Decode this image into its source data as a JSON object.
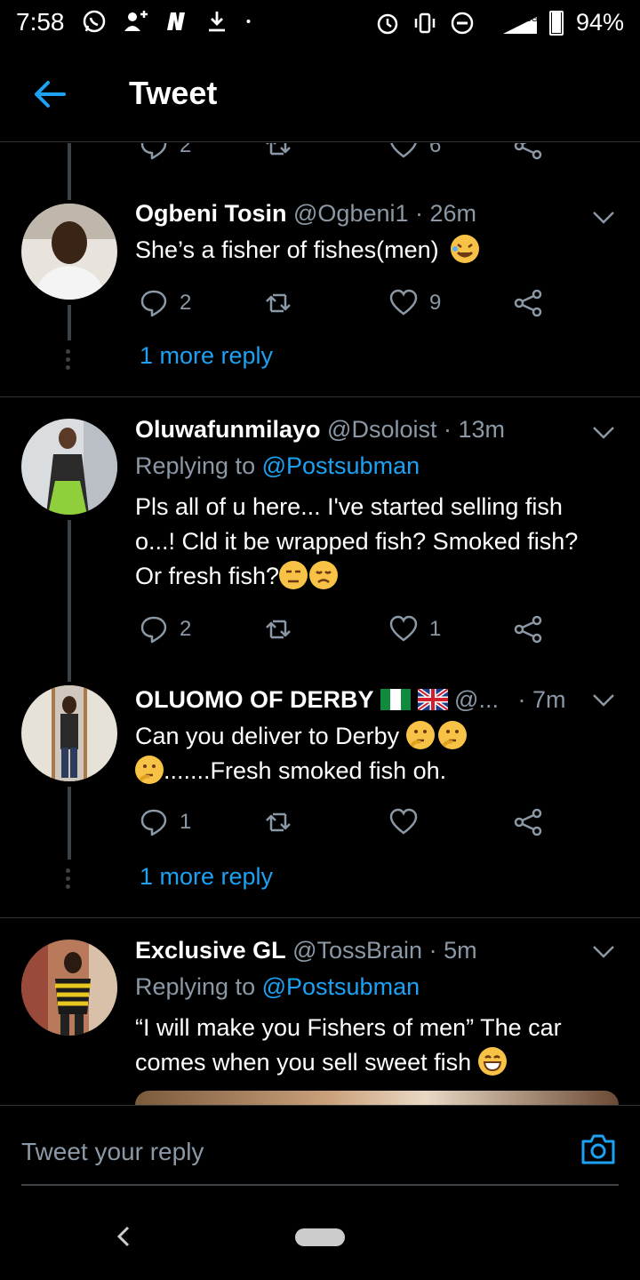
{
  "status_bar": {
    "time": "7:58",
    "battery": "94%",
    "network": "3G",
    "icons": [
      "whatsapp-icon",
      "add-contact-icon",
      "n-app-icon",
      "download-icon",
      "dot-icon",
      "alarm-icon",
      "vibrate-icon",
      "dnd-icon",
      "signal-icon",
      "battery-icon"
    ]
  },
  "header": {
    "title": "Tweet"
  },
  "partial_actions": {
    "reply_count": "2",
    "like_count": "6"
  },
  "tweets": [
    {
      "name": "Ogbeni Tosin",
      "handle": "@Ogbeni1",
      "time": "· 26m",
      "text": "She’s a fisher of fishes(men)",
      "emoji": [
        "rolling-on-floor-laughing-emoji"
      ],
      "reply_count": "2",
      "retweet_count": "",
      "like_count": "9",
      "more_reply": "1 more reply"
    },
    {
      "name": "Oluwafunmilayo",
      "handle": "@Dsoloist",
      "time": "· 13m",
      "replying_prefix": "Replying to",
      "replying_to": "@Postsubman",
      "text_lines": [
        "Pls all of u here... I've started selling fish",
        "o...! Cld it be wrapped fish? Smoked fish?",
        "Or fresh fish?"
      ],
      "emoji": [
        "unamused-emoji",
        "disappointed-emoji"
      ],
      "reply_count": "2",
      "retweet_count": "",
      "like_count": "1"
    },
    {
      "name": "OLUOMO OF DERBY",
      "handle": "@...",
      "time": "· 7m",
      "text_line1": "Can you deliver to Derby",
      "text_line2": ".......Fresh smoked fish oh.",
      "emoji": [
        "thinking-emoji",
        "thinking-emoji",
        "thinking-emoji"
      ],
      "flags": [
        "nigeria-flag",
        "uk-flag"
      ],
      "reply_count": "1",
      "retweet_count": "",
      "like_count": "",
      "more_reply": "1 more reply"
    },
    {
      "name": "Exclusive GL",
      "handle": "@TossBrain",
      "time": "· 5m",
      "replying_prefix": "Replying to",
      "replying_to": "@Postsubman",
      "text_lines": [
        "“I will make you Fishers of men” The car",
        "comes when you sell sweet fish"
      ],
      "emoji": [
        "grinning-emoji"
      ]
    }
  ],
  "composer": {
    "placeholder": "Tweet your reply"
  },
  "colors": {
    "accent": "#1da1f2",
    "secondary_text": "#8b98a5",
    "background": "#000000",
    "divider": "#2f3336"
  }
}
